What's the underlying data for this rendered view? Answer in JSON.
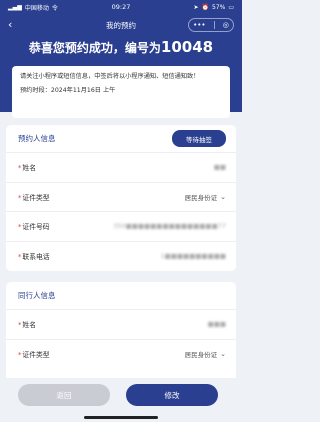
{
  "status_bar": {
    "carrier": "中国移动",
    "network": "令",
    "time": "09:27",
    "battery": "57%"
  },
  "nav": {
    "title": "我的预约",
    "menu_glyph": "•••",
    "close_glyph": "◎"
  },
  "success": {
    "prefix": "恭喜您预约成功，编号为",
    "number": "10048"
  },
  "notice": {
    "text": "请关注小程序或短信信息，中签后将以小程序通知、短信通知致！",
    "time_label": "预约时段：2024年11月16日 上午"
  },
  "booker": {
    "title": "预约人信息",
    "status": "等待抽签",
    "fields": [
      {
        "label": "姓名",
        "value": "■■"
      },
      {
        "label": "证件类型",
        "value": "居民身份证"
      },
      {
        "label": "证件号码",
        "value": "350■■■■■■■■■■■■■■■77"
      },
      {
        "label": "联系电话",
        "value": "1■■■■■■■■■■"
      }
    ]
  },
  "companion": {
    "title": "同行人信息",
    "fields": [
      {
        "label": "姓名",
        "value": "■■■"
      },
      {
        "label": "证件类型",
        "value": "居民身份证"
      }
    ]
  },
  "footer": {
    "back_label": "返回",
    "edit_label": "修改"
  },
  "colors": {
    "primary": "#2a3f8f",
    "background": "#eef1f6",
    "required_star": "#e04040",
    "disabled_button": "#c9ccd3"
  }
}
